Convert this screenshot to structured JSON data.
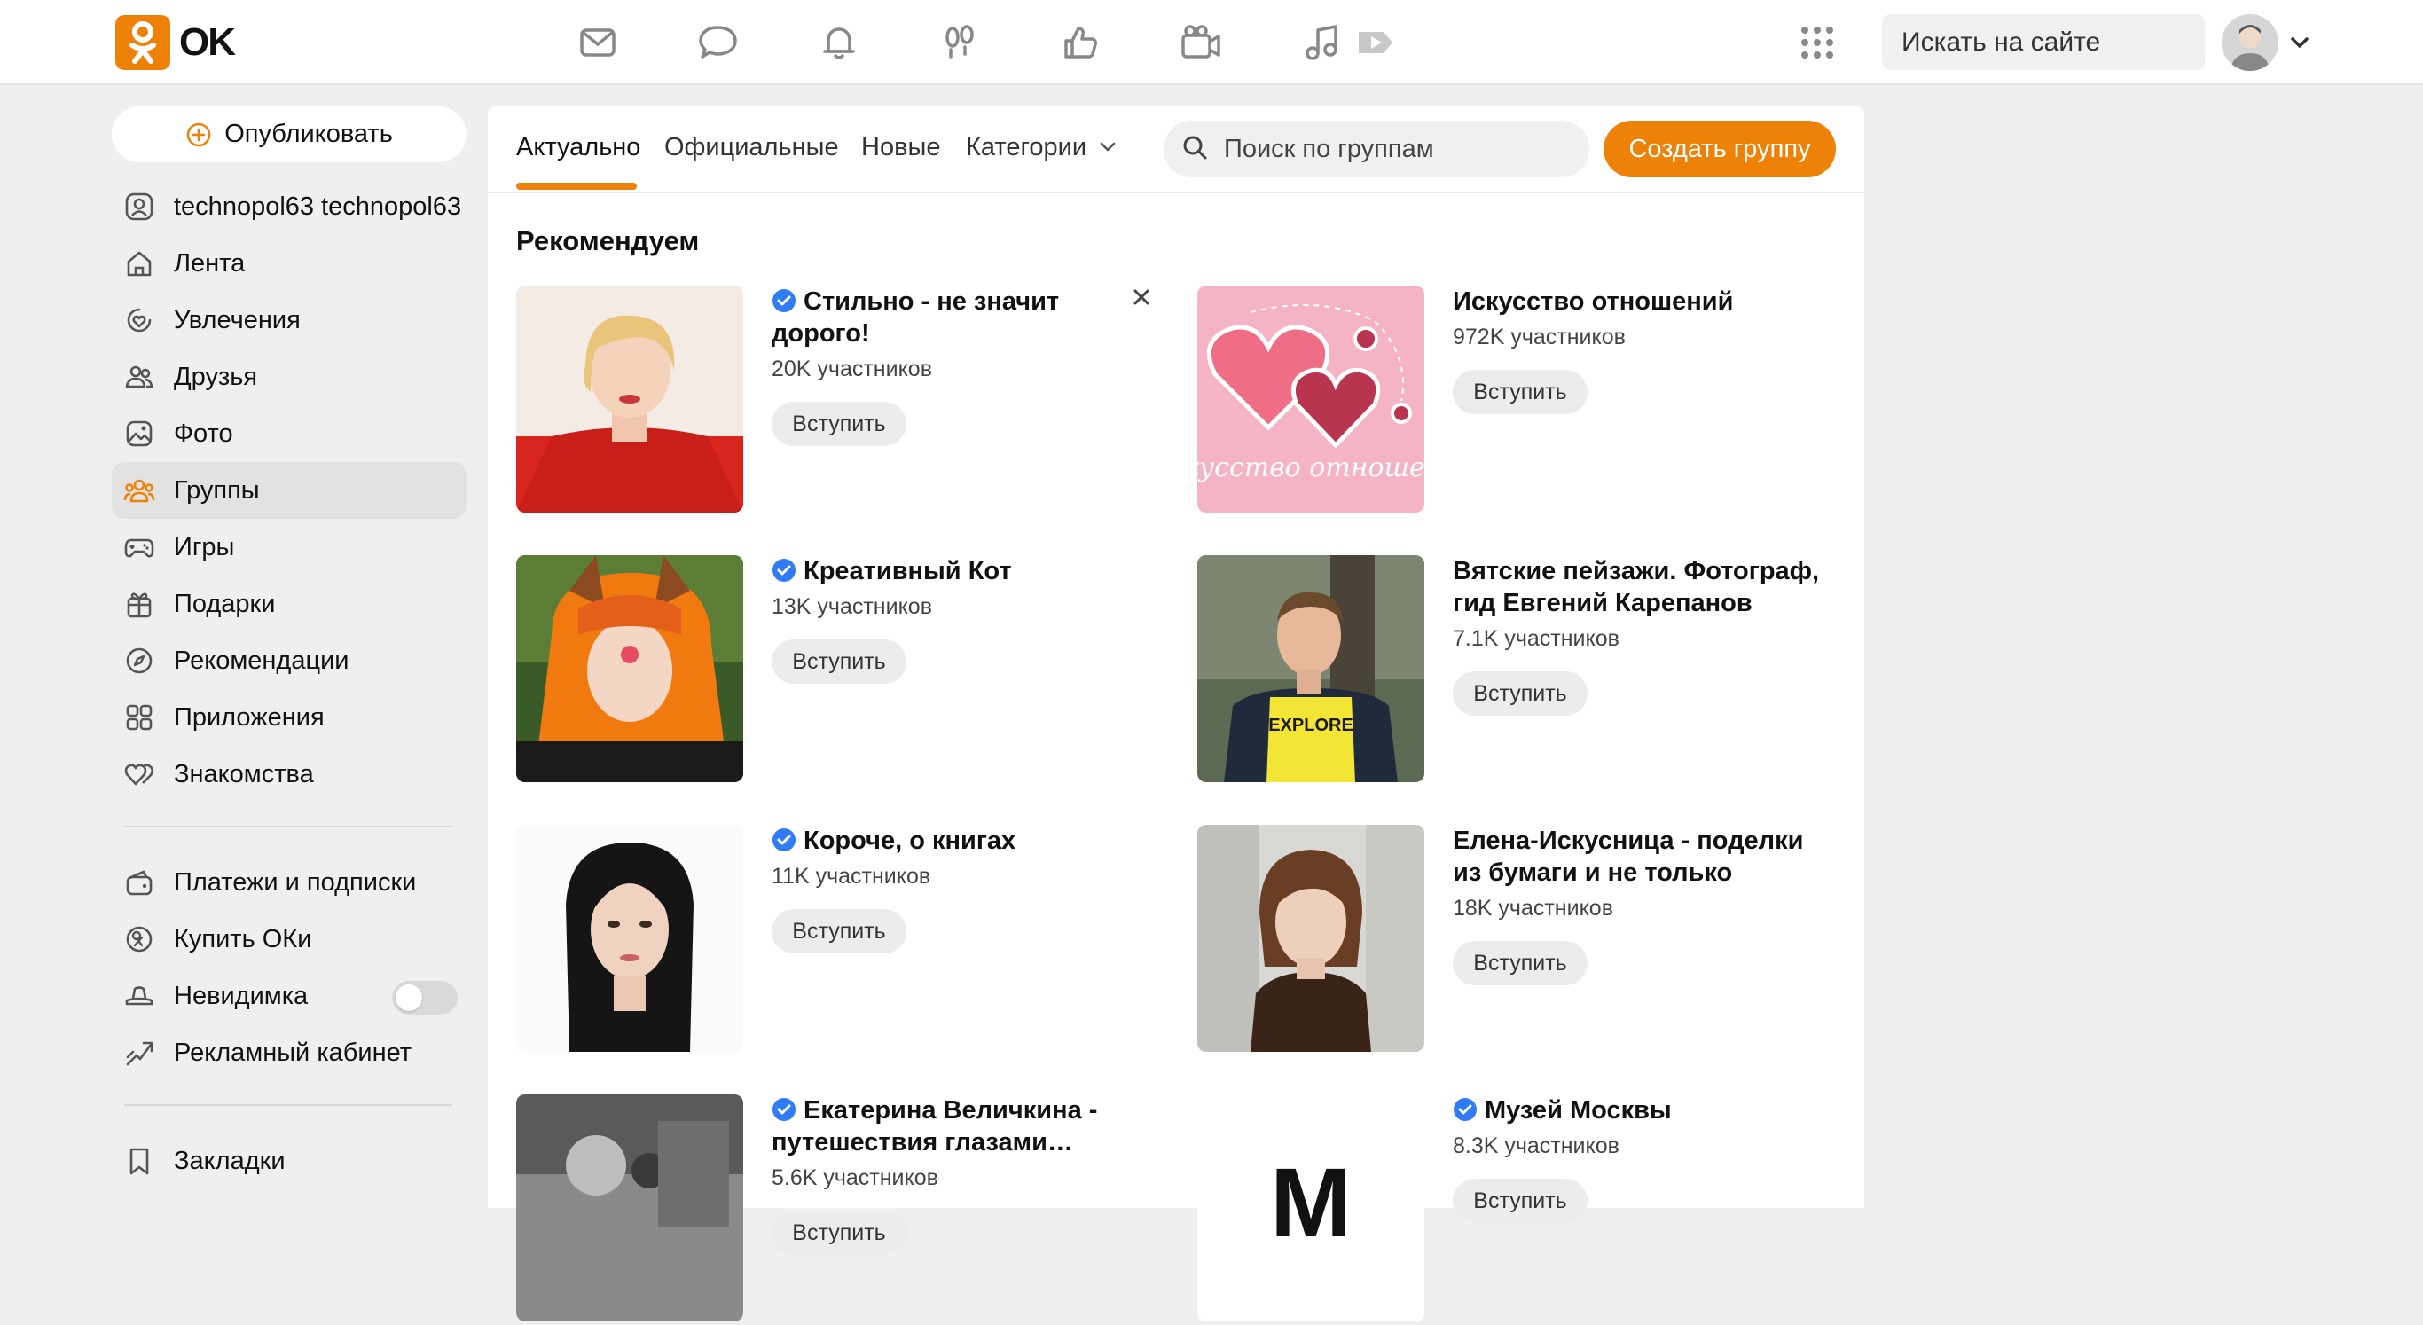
{
  "header": {
    "logo_text": "OK",
    "nav": [
      {
        "name": "messages-icon"
      },
      {
        "name": "discussions-icon"
      },
      {
        "name": "notifications-icon"
      },
      {
        "name": "guests-icon"
      },
      {
        "name": "events-icon"
      },
      {
        "name": "video-icon"
      },
      {
        "name": "music-icon"
      }
    ],
    "search_placeholder": "Искать на сайте"
  },
  "sidebar": {
    "publish_label": "Опубликовать",
    "items": [
      {
        "label": "technopol63 technopol63",
        "icon": "profile-icon"
      },
      {
        "label": "Лента",
        "icon": "home-icon"
      },
      {
        "label": "Увлечения",
        "icon": "hobbies-icon"
      },
      {
        "label": "Друзья",
        "icon": "friends-icon"
      },
      {
        "label": "Фото",
        "icon": "photo-icon"
      },
      {
        "label": "Группы",
        "icon": "groups-icon",
        "active": true
      },
      {
        "label": "Игры",
        "icon": "games-icon"
      },
      {
        "label": "Подарки",
        "icon": "gifts-icon"
      },
      {
        "label": "Рекомендации",
        "icon": "recommendations-icon"
      },
      {
        "label": "Приложения",
        "icon": "apps-icon"
      },
      {
        "label": "Знакомства",
        "icon": "dating-icon"
      }
    ],
    "items2": [
      {
        "label": "Платежи и подписки",
        "icon": "wallet-icon"
      },
      {
        "label": "Купить ОКи",
        "icon": "coins-icon"
      },
      {
        "label": "Невидимка",
        "icon": "invisible-icon",
        "toggle": false
      },
      {
        "label": "Рекламный кабинет",
        "icon": "ads-icon"
      }
    ],
    "items3": [
      {
        "label": "Закладки",
        "icon": "bookmark-icon"
      }
    ]
  },
  "main": {
    "tabs": [
      "Актуально",
      "Официальные",
      "Новые",
      "Категории"
    ],
    "active_tab": "Актуально",
    "group_search_placeholder": "Поиск по группам",
    "create_label": "Создать группу",
    "section_title": "Рекомендуем",
    "join_label": "Вступить",
    "groups": [
      {
        "name": "Стильно - не значит дорого!",
        "members": "20K участников",
        "verified": true
      },
      {
        "name": "Искусство отношений",
        "members": "972K участников",
        "verified": false,
        "thumb_text": "Искусство отношений"
      },
      {
        "name": "Креативный Кот",
        "members": "13K участников",
        "verified": true
      },
      {
        "name": "Вятские пейзажи. Фотограф, гид Евгений Карепанов",
        "members": "7.1K участников",
        "verified": false,
        "thumb_text": "EXPLORE"
      },
      {
        "name": "Короче, о книгах",
        "members": "11K участников",
        "verified": true
      },
      {
        "name": "Елена-Искусница - поделки из бумаги и не только",
        "members": "18K участников",
        "verified": false
      },
      {
        "name": "Екатерина Величкина - путешествия глазами…",
        "members": "5.6K участников",
        "verified": true
      },
      {
        "name": "Музей Москвы",
        "members": "8.3K участников",
        "verified": true,
        "thumb_text": "М"
      }
    ]
  },
  "colors": {
    "accent": "#ee8208",
    "verified": "#2f7cf6"
  }
}
